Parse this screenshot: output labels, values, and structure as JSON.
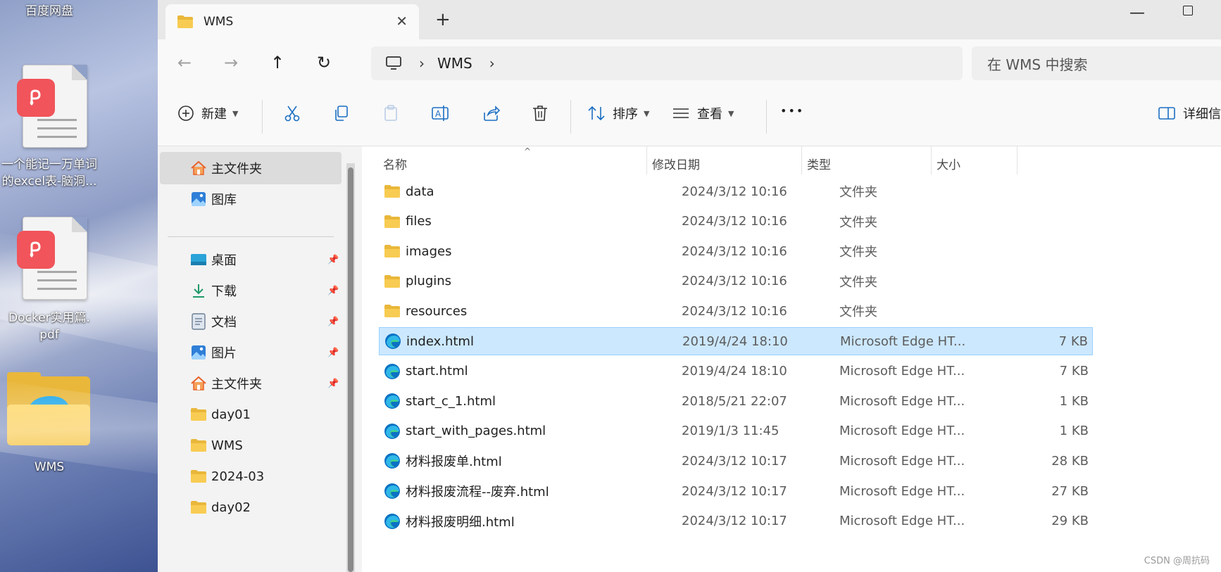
{
  "desktop": {
    "top_label": "百度网盘",
    "items": [
      {
        "label_line1": "一个能记一万单词",
        "label_line2": "的excel表-脑洞..."
      },
      {
        "label_line1": "Docker实用篇.",
        "label_line2": "pdf"
      },
      {
        "label_line1": "WMS",
        "label_line2": ""
      }
    ]
  },
  "window": {
    "tab_title": "WMS",
    "new_tab": "+",
    "breadcrumb": {
      "current": "WMS"
    },
    "search_placeholder": "在 WMS 中搜索"
  },
  "toolbar": {
    "new_label": "新建",
    "sort_label": "排序",
    "view_label": "查看",
    "more_label": "•••",
    "details_label": "详细信"
  },
  "nav": {
    "items": [
      {
        "label": "主文件夹",
        "icon": "home-icon"
      },
      {
        "label": "图库",
        "icon": "gallery-icon"
      },
      {
        "label": "桌面",
        "icon": "desktop-folder-icon"
      },
      {
        "label": "下载",
        "icon": "download-icon"
      },
      {
        "label": "文档",
        "icon": "documents-icon"
      },
      {
        "label": "图片",
        "icon": "pictures-icon"
      },
      {
        "label": "主文件夹",
        "icon": "home-icon"
      },
      {
        "label": "day01",
        "icon": "folder-icon"
      },
      {
        "label": "WMS",
        "icon": "folder-icon"
      },
      {
        "label": "2024-03",
        "icon": "folder-icon"
      },
      {
        "label": "day02",
        "icon": "folder-icon"
      }
    ]
  },
  "columns": {
    "name": "名称",
    "date": "修改日期",
    "type": "类型",
    "size": "大小"
  },
  "files": [
    {
      "name": "data",
      "date": "2024/3/12 10:16",
      "type": "文件夹",
      "size": "",
      "kind": "folder"
    },
    {
      "name": "files",
      "date": "2024/3/12 10:16",
      "type": "文件夹",
      "size": "",
      "kind": "folder"
    },
    {
      "name": "images",
      "date": "2024/3/12 10:16",
      "type": "文件夹",
      "size": "",
      "kind": "folder"
    },
    {
      "name": "plugins",
      "date": "2024/3/12 10:16",
      "type": "文件夹",
      "size": "",
      "kind": "folder"
    },
    {
      "name": "resources",
      "date": "2024/3/12 10:16",
      "type": "文件夹",
      "size": "",
      "kind": "folder"
    },
    {
      "name": "index.html",
      "date": "2019/4/24 18:10",
      "type": "Microsoft Edge HT...",
      "size": "7 KB",
      "kind": "edge"
    },
    {
      "name": "start.html",
      "date": "2019/4/24 18:10",
      "type": "Microsoft Edge HT...",
      "size": "7 KB",
      "kind": "edge"
    },
    {
      "name": "start_c_1.html",
      "date": "2018/5/21 22:07",
      "type": "Microsoft Edge HT...",
      "size": "1 KB",
      "kind": "edge"
    },
    {
      "name": "start_with_pages.html",
      "date": "2019/1/3 11:45",
      "type": "Microsoft Edge HT...",
      "size": "1 KB",
      "kind": "edge"
    },
    {
      "name": "材料报废单.html",
      "date": "2024/3/12 10:17",
      "type": "Microsoft Edge HT...",
      "size": "28 KB",
      "kind": "edge"
    },
    {
      "name": "材料报废流程--废弃.html",
      "date": "2024/3/12 10:17",
      "type": "Microsoft Edge HT...",
      "size": "27 KB",
      "kind": "edge"
    },
    {
      "name": "材料报废明细.html",
      "date": "2024/3/12 10:17",
      "type": "Microsoft Edge HT...",
      "size": "29 KB",
      "kind": "edge"
    }
  ],
  "selected_file": "index.html",
  "watermark": "CSDN @周抗码",
  "colors": {
    "selection": "#cce8ff",
    "selection_border": "#99d1ff",
    "folder": "#f5c445",
    "accent": "#0067c0"
  }
}
